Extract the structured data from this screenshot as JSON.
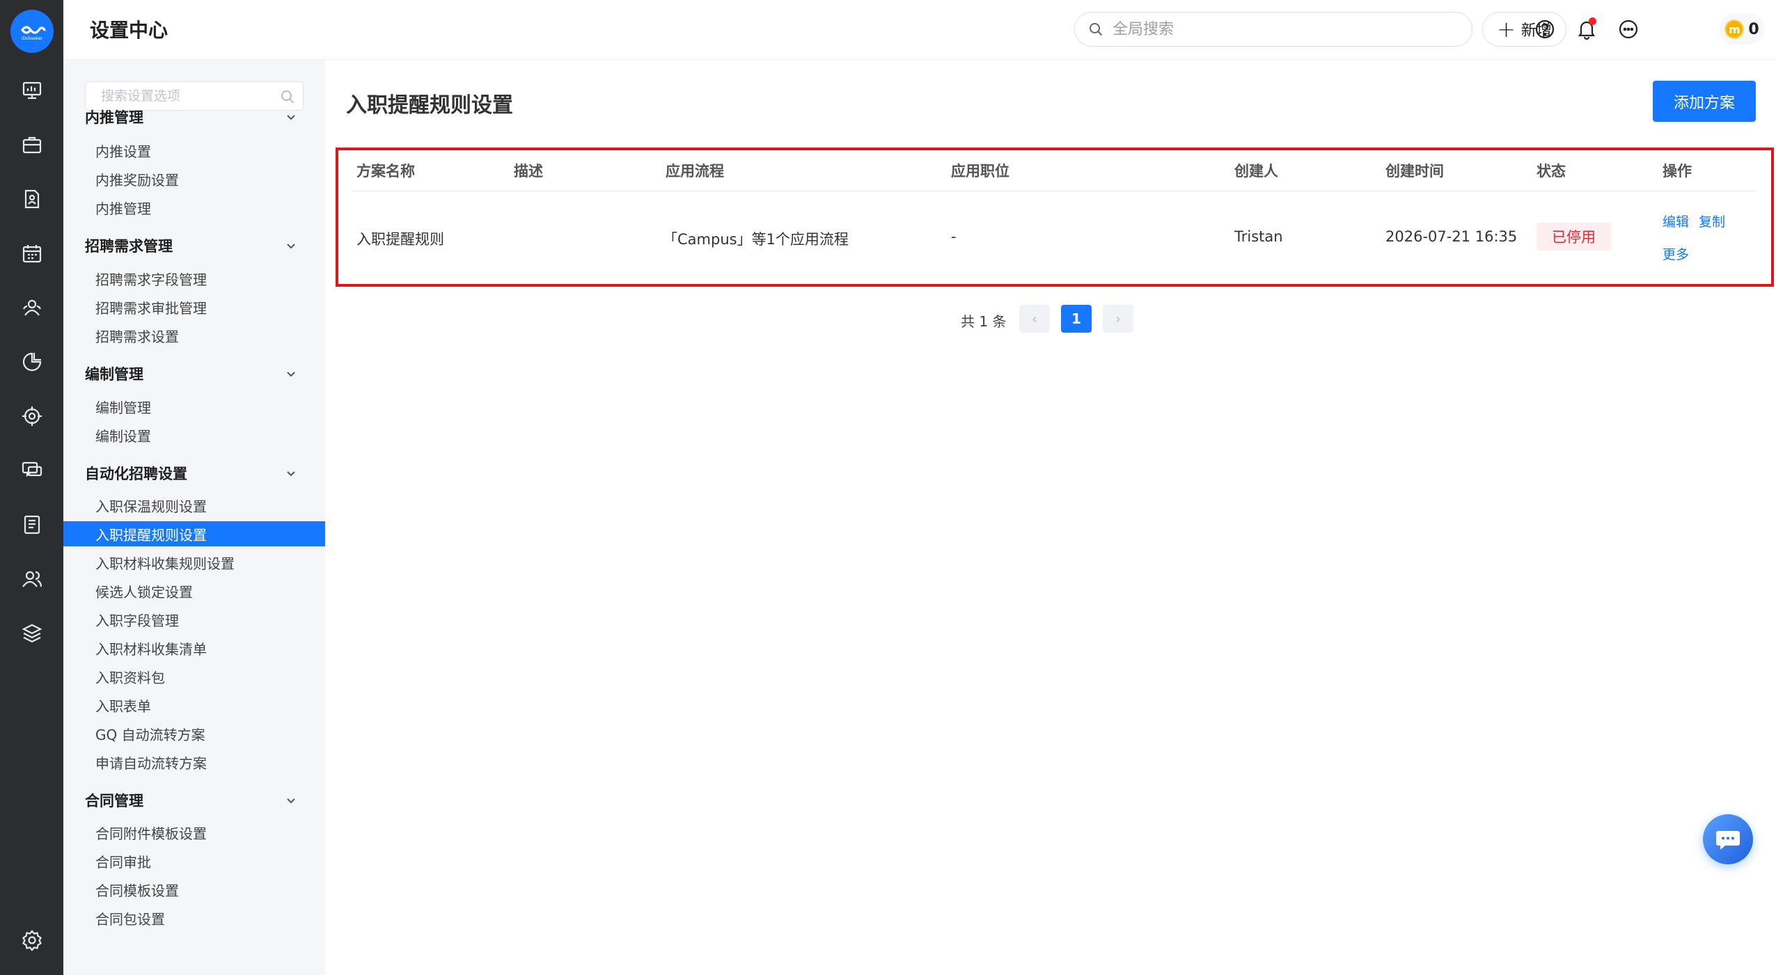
{
  "app": {
    "title": "设置中心",
    "logo_text": "iDoSeeker"
  },
  "header": {
    "search_placeholder": "全局搜索",
    "new_label": "新增",
    "coin_count": "0",
    "coin_symbol": "m"
  },
  "sidebar": {
    "search_placeholder": "搜索设置选项",
    "groups": [
      {
        "title": "内推管理",
        "items": [
          "内推设置",
          "内推奖励设置",
          "内推管理"
        ]
      },
      {
        "title": "招聘需求管理",
        "items": [
          "招聘需求字段管理",
          "招聘需求审批管理",
          "招聘需求设置"
        ]
      },
      {
        "title": "编制管理",
        "items": [
          "编制管理",
          "编制设置"
        ]
      },
      {
        "title": "自动化招聘设置",
        "items": [
          "入职保温规则设置",
          "入职提醒规则设置",
          "入职材料收集规则设置",
          "候选人锁定设置",
          "入职字段管理",
          "入职材料收集清单",
          "入职资料包",
          "入职表单",
          "GQ 自动流转方案",
          "申请自动流转方案"
        ]
      },
      {
        "title": "合同管理",
        "items": [
          "合同附件模板设置",
          "合同审批",
          "合同模板设置",
          "合同包设置"
        ]
      }
    ],
    "active_item": "入职提醒规则设置"
  },
  "main": {
    "title": "入职提醒规则设置",
    "add_button": "添加方案",
    "table": {
      "columns": [
        "方案名称",
        "描述",
        "应用流程",
        "应用职位",
        "创建人",
        "创建时间",
        "状态",
        "操作"
      ],
      "rows": [
        {
          "name": "入职提醒规则",
          "description": "",
          "process": "「Campus」等1个应用流程",
          "position": "-",
          "creator": "Tristan",
          "created_at": "2026-07-21 16:35",
          "status": "已停用",
          "actions": [
            "编辑",
            "复制",
            "更多"
          ]
        }
      ]
    },
    "pagination": {
      "total": "共 1 条",
      "current": "1",
      "prev": "‹",
      "next": "›"
    }
  },
  "colors": {
    "primary": "#1677ff",
    "rail": "#2b2d31",
    "highlight_border": "#e4121a",
    "status_disabled": "#e02b35"
  }
}
